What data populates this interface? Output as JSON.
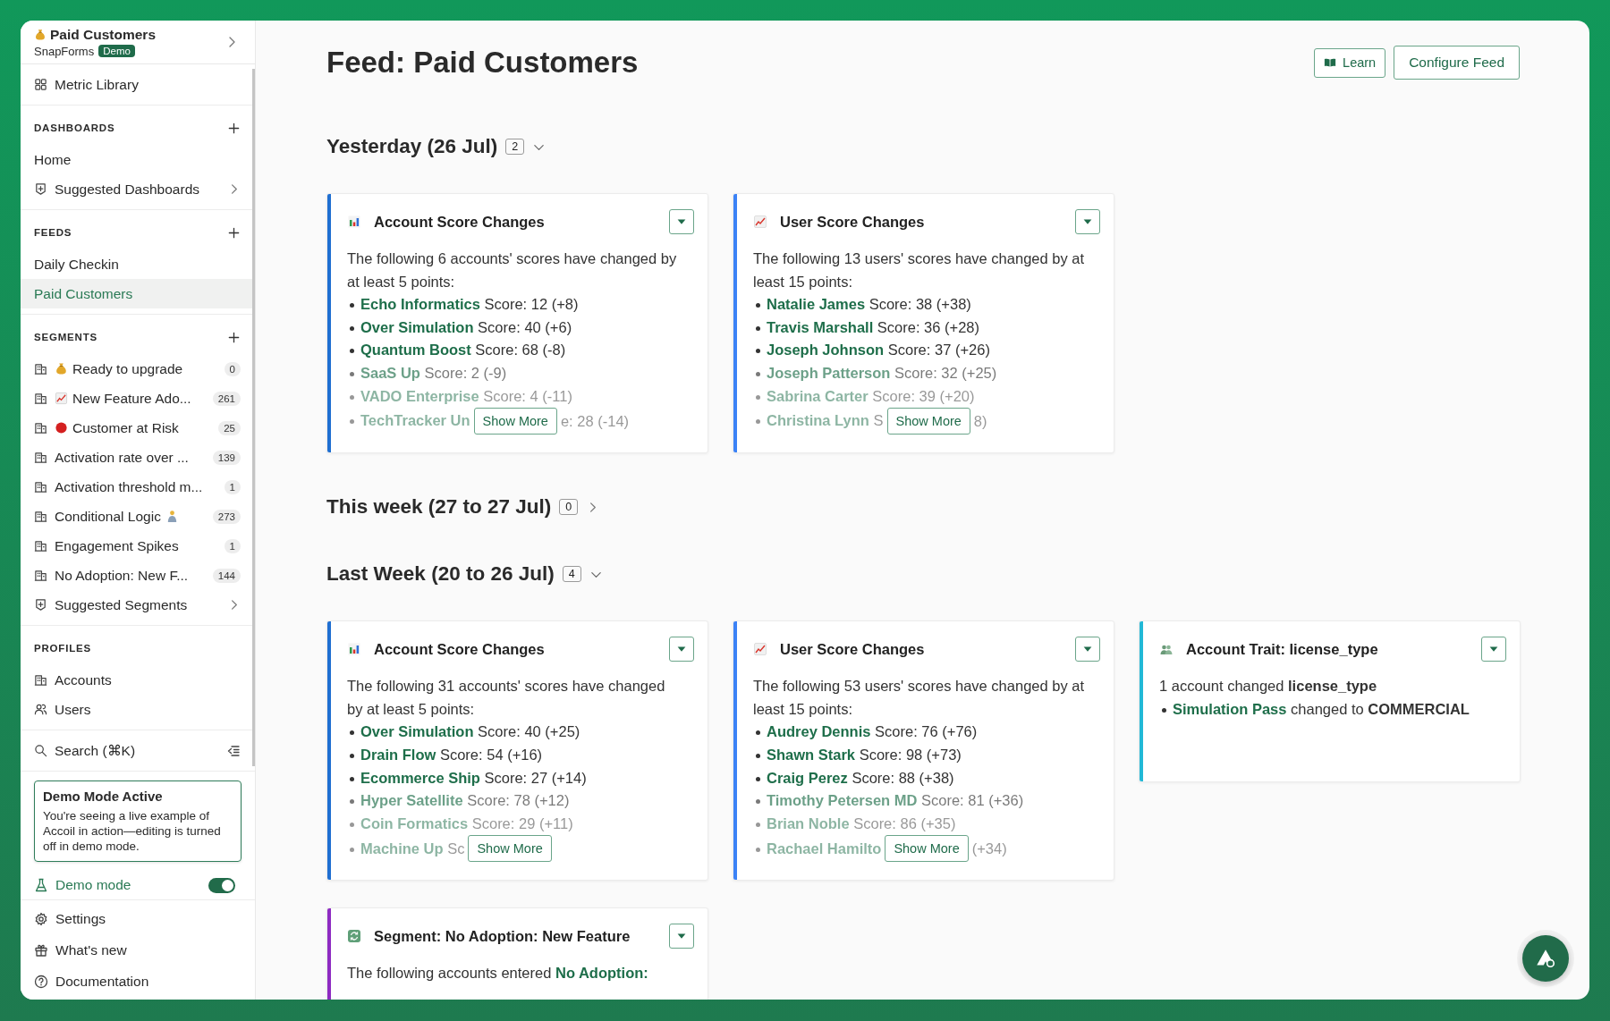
{
  "sidebar": {
    "workspace": {
      "title": "Paid Customers",
      "org": "SnapForms",
      "badge": "Demo"
    },
    "top_items": [
      {
        "label": "Metric Library",
        "kind": "library",
        "selected": false
      }
    ],
    "sections": [
      {
        "heading": "DASHBOARDS",
        "add": true,
        "items": [
          {
            "label": "Home",
            "kind": "plain",
            "selected": false
          },
          {
            "label": "Suggested Dashboards",
            "kind": "suggested",
            "selected": false
          }
        ]
      },
      {
        "heading": "FEEDS",
        "add": true,
        "items": [
          {
            "label": "Daily Checkin",
            "kind": "plain",
            "selected": false
          },
          {
            "label": "Paid Customers",
            "kind": "plain",
            "selected": true
          }
        ]
      },
      {
        "heading": "SEGMENTS",
        "add": true,
        "items": [
          {
            "label": "Ready to upgrade",
            "kind": "money_segment",
            "count": "0",
            "selected": false
          },
          {
            "label": "New Feature Ado...",
            "kind": "chart_segment",
            "count": "261",
            "selected": false
          },
          {
            "label": "Customer at Risk",
            "kind": "alert_segment",
            "count": "25",
            "selected": false
          },
          {
            "label": "Activation rate over ...",
            "kind": "segment",
            "count": "139",
            "selected": false
          },
          {
            "label": "Activation threshold m...",
            "kind": "segment",
            "count": "1",
            "selected": false
          },
          {
            "label": "Conditional Logic",
            "kind": "person_segment",
            "count": "273",
            "selected": false
          },
          {
            "label": "Engagement Spikes",
            "kind": "segment",
            "count": "1",
            "selected": false
          },
          {
            "label": "No Adoption: New F...",
            "kind": "segment",
            "count": "144",
            "selected": false
          },
          {
            "label": "Suggested Segments",
            "kind": "suggested",
            "selected": false
          }
        ]
      },
      {
        "heading": "PROFILES",
        "add": false,
        "items": [
          {
            "label": "Accounts",
            "kind": "segment",
            "selected": false
          },
          {
            "label": "Users",
            "kind": "users",
            "selected": false
          }
        ]
      }
    ],
    "search": {
      "label": "Search (⌘K)"
    },
    "notice": {
      "title": "Demo Mode Active",
      "text": "You're seeing a live example of Accoil in action—editing is turned off in demo mode."
    },
    "demo_mode": {
      "label": "Demo mode",
      "on": true
    },
    "footer_items": [
      {
        "label": "Settings",
        "kind": "settings"
      },
      {
        "label": "What's new",
        "kind": "updates"
      },
      {
        "label": "Documentation",
        "kind": "docs"
      }
    ]
  },
  "main": {
    "title": "Feed: Paid Customers",
    "buttons": [
      {
        "label": "Learn",
        "kind": "learn"
      },
      {
        "label": "Configure Feed",
        "kind": "configure"
      }
    ],
    "sections": [
      {
        "title": "Yesterday (26 Jul)",
        "count": "2",
        "expanded": true,
        "cards": [
          {
            "kind": "account_score",
            "color": "#1f6fd1",
            "title": "Account Score Changes",
            "intro": "The following 6 accounts' scores have changed by at least 5 points:",
            "items": [
              {
                "name": "Echo Informatics",
                "text": "Score: 12 (+8)"
              },
              {
                "name": "Over Simulation",
                "text": "Score: 40 (+6)"
              },
              {
                "name": "Quantum Boost",
                "text": "Score: 68 (-8)"
              },
              {
                "name": "SaaS Up",
                "text": "Score: 2 (-9)"
              },
              {
                "name": "VADO Enterprise",
                "text": "Score: 4 (-11)"
              }
            ],
            "more": {
              "name": "TechTracker Un",
              "after": "e: 28 (-14)"
            },
            "button": "Show More"
          },
          {
            "kind": "user_score",
            "color": "#3b82f6",
            "title": "User Score Changes",
            "intro": "The following 13 users' scores have changed by at least 15 points:",
            "items": [
              {
                "name": "Natalie James",
                "text": "Score: 38 (+38)"
              },
              {
                "name": "Travis Marshall",
                "text": "Score: 36 (+28)"
              },
              {
                "name": "Joseph Johnson",
                "text": "Score: 37 (+26)"
              },
              {
                "name": "Joseph Patterson",
                "text": "Score: 32 (+25)"
              },
              {
                "name": "Sabrina Carter",
                "text": "Score: 39 (+20)"
              }
            ],
            "more": {
              "name": "Christina Lynn",
              "before": "S",
              "after": "8)"
            },
            "button": "Show More"
          }
        ]
      },
      {
        "title": "This week (27 to 27 Jul)",
        "count": "0",
        "expanded": false
      },
      {
        "title": "Last Week (20 to 26 Jul)",
        "count": "4",
        "expanded": true,
        "cards": [
          {
            "kind": "account_score",
            "color": "#1f6fd1",
            "title": "Account Score Changes",
            "intro": "The following 31 accounts' scores have changed by at least 5 points:",
            "items": [
              {
                "name": "Over Simulation",
                "text": "Score: 40 (+25)"
              },
              {
                "name": "Drain Flow",
                "text": "Score: 54 (+16)"
              },
              {
                "name": "Ecommerce Ship",
                "text": "Score: 27 (+14)"
              },
              {
                "name": "Hyper Satellite",
                "text": "Score: 78 (+12)"
              },
              {
                "name": "Coin Formatics",
                "text": "Score: 29 (+11)"
              }
            ],
            "more": {
              "name": "Machine Up",
              "before": "Sc"
            },
            "button": "Show More"
          },
          {
            "kind": "user_score",
            "color": "#3b82f6",
            "title": "User Score Changes",
            "intro": "The following 53 users' scores have changed by at least 15 points:",
            "items": [
              {
                "name": "Audrey Dennis",
                "text": "Score: 76 (+76)"
              },
              {
                "name": "Shawn Stark",
                "text": "Score: 98 (+73)"
              },
              {
                "name": "Craig Perez",
                "text": "Score: 88 (+38)"
              },
              {
                "name": "Timothy Petersen MD",
                "text": "Score: 81 (+36)"
              },
              {
                "name": "Brian Noble",
                "text": "Score: 86 (+35)"
              }
            ],
            "more": {
              "name": "Rachael Hamilto",
              "after": "(+34)"
            },
            "button": "Show More"
          },
          {
            "kind": "trait",
            "color": "#22b8d6",
            "title": "Account Trait: license_type",
            "intro": "1 account changed **license_type**",
            "items": [
              {
                "name": "Simulation Pass",
                "text": "changed to **COMMERCIAL**"
              }
            ]
          },
          {
            "kind": "segment",
            "color": "#8e2bc2",
            "title": "Segment: No Adoption: New Feature",
            "intro": "The following accounts entered",
            "link": "No Adoption:"
          }
        ]
      }
    ]
  }
}
